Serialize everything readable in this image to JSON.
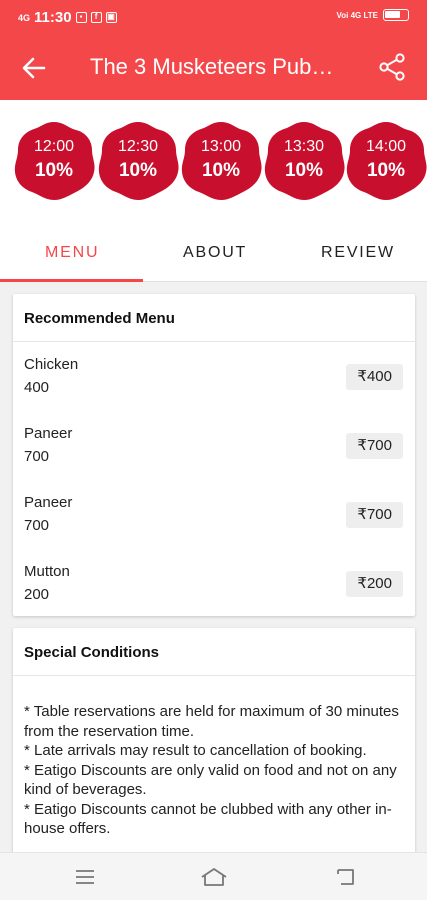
{
  "status_bar": {
    "time": "11:30",
    "network": "4G",
    "right_text": "Voi 4G LTE"
  },
  "app_bar": {
    "title": "The 3 Musketeers Pub…"
  },
  "time_slots": [
    {
      "time": "12:00",
      "discount": "10%"
    },
    {
      "time": "12:30",
      "discount": "10%"
    },
    {
      "time": "13:00",
      "discount": "10%"
    },
    {
      "time": "13:30",
      "discount": "10%"
    },
    {
      "time": "14:00",
      "discount": "10%"
    }
  ],
  "tabs": [
    {
      "label": "MENU",
      "active": true
    },
    {
      "label": "ABOUT",
      "active": false
    },
    {
      "label": "REVIEW",
      "active": false
    }
  ],
  "recommended_menu": {
    "title": "Recommended Menu",
    "items": [
      {
        "name": "Chicken",
        "qty": "400",
        "price": "₹400"
      },
      {
        "name": "Paneer",
        "qty": "700",
        "price": "₹700"
      },
      {
        "name": "Paneer",
        "qty": "700",
        "price": "₹700"
      },
      {
        "name": "Mutton",
        "qty": "200",
        "price": "₹200"
      }
    ]
  },
  "special_conditions": {
    "title": "Special Conditions",
    "lines": [
      "* Table reservations are held for maximum of 30 minutes from the reservation time.",
      "* Late arrivals may result to cancellation of booking.",
      "* Eatigo Discounts are only valid on food and not on any kind of beverages.",
      "* Eatigo Discounts cannot be clubbed with any other in-house offers."
    ]
  },
  "colors": {
    "brand": "#f4474a",
    "slot_badge": "#c8102e"
  },
  "icons": {
    "back": "arrow-left-icon",
    "share": "share-icon",
    "nav_menu": "menu-lines-icon",
    "nav_home": "home-icon",
    "nav_back": "back-icon"
  }
}
